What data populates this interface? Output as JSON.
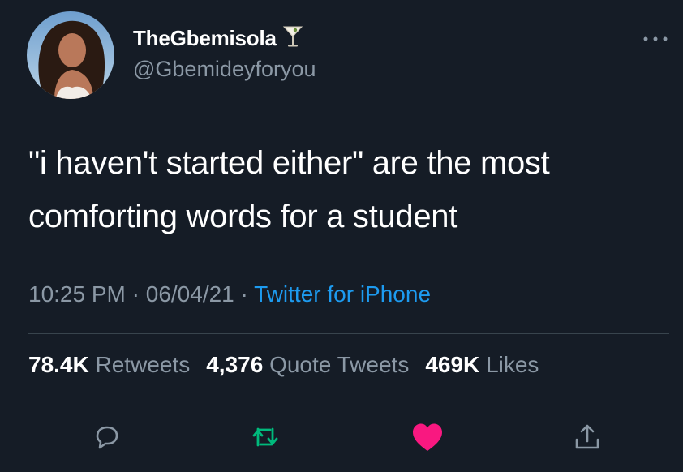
{
  "tweet": {
    "author": {
      "display_name": "TheGbemisola",
      "name_emoji": "cocktail-glass-icon",
      "handle": "@Gbemideyforyou"
    },
    "text": "\"i haven't started either\" are the most comforting words for a student",
    "time": "10:25 PM",
    "separator": "·",
    "date": "06/04/21",
    "source": "Twitter for iPhone",
    "stats": {
      "retweets_count": "78.4K",
      "retweets_label": "Retweets",
      "quotes_count": "4,376",
      "quotes_label": "Quote Tweets",
      "likes_count": "469K",
      "likes_label": "Likes"
    },
    "actions": {
      "reply_icon": "reply-bubble-icon",
      "retweet_icon": "retweet-icon",
      "like_icon": "heart-icon",
      "share_icon": "share-icon"
    }
  },
  "colors": {
    "background": "#151c26",
    "text_primary": "#ffffff",
    "text_secondary": "#8b98a5",
    "link": "#1d9bf0",
    "retweet_active": "#00ba7c",
    "like_active": "#f91880",
    "divider": "#38444d"
  }
}
